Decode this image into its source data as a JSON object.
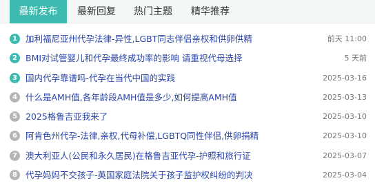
{
  "tabs": [
    {
      "label": "最新发布",
      "active": true
    },
    {
      "label": "最新回复",
      "active": false
    },
    {
      "label": "热门主题",
      "active": false
    },
    {
      "label": "精华推荐",
      "active": false
    }
  ],
  "posts": [
    {
      "num": "1",
      "title": "加利福尼亚州代孕法律-异性,LGBT同志伴侣亲权和供卵供精",
      "date": "前天 11:00"
    },
    {
      "num": "2",
      "title": "BMI对试管婴儿和代孕最终成功率的影响 请重视代母选择",
      "date": "5 天前"
    },
    {
      "num": "3",
      "title": "国内代孕靠谱吗-代孕在当代中国的实践",
      "date": "2025-03-16"
    },
    {
      "num": "4",
      "title": "什么是AMH值,各年龄段AMH值是多少,如何提高AMH值",
      "date": "2025-03-13"
    },
    {
      "num": "5",
      "title": "2025格鲁吉亚我来了",
      "date": "2025-03-10"
    },
    {
      "num": "6",
      "title": "阿肯色州代孕-法律,亲权,代母补偿,LGBTQ同性伴侣,供卵捐精",
      "date": "2025-03-10"
    },
    {
      "num": "7",
      "title": "澳大利亚人(公民和永久居民)在格鲁吉亚代孕-护照和旅行证",
      "date": "2025-03-07"
    },
    {
      "num": "8",
      "title": "代孕妈妈不交孩子-英国家庭法院关于孩子监护权纠纷的判决",
      "date": "2025-03-04"
    }
  ],
  "colors": {
    "accent": "#3ebbb0",
    "link": "#2b46a8",
    "muted_badge": "#b5b5b5",
    "date": "#777777",
    "tabbar_bg": "#f3f7f7"
  }
}
